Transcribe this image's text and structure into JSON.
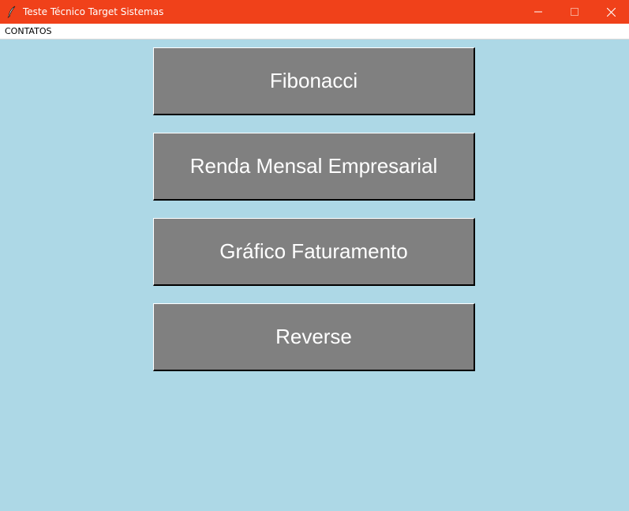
{
  "window": {
    "title": "Teste Técnico Target Sistemas",
    "app_icon": "feather-icon",
    "titlebar_color": "#f0411a",
    "background_color": "#add8e6"
  },
  "menubar": {
    "items": [
      {
        "label": "CONTATOS"
      }
    ]
  },
  "buttons": [
    {
      "label": "Fibonacci"
    },
    {
      "label": "Renda Mensal Empresarial"
    },
    {
      "label": "Gráfico Faturamento"
    },
    {
      "label": "Reverse"
    }
  ],
  "button_color": "#808080"
}
